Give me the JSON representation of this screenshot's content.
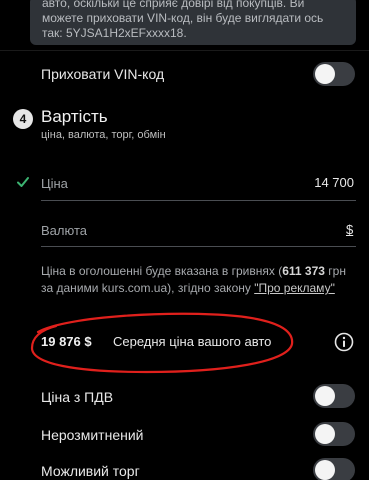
{
  "vin_info": {
    "line1": "авто, оскільки це сприяє довірі від покупців. Ви",
    "line2": "можете приховати VIN-код, він буде виглядати ось",
    "line3": "так: 5YJSA1H2xEFxxxx18."
  },
  "hide_vin": {
    "label": "Приховати VIN-код",
    "enabled": false
  },
  "price_section": {
    "step_number": "4",
    "title": "Вартість",
    "subtitle": "ціна, валюта, торг, обмін"
  },
  "price_field": {
    "label": "Ціна",
    "value": "14 700"
  },
  "currency_field": {
    "label": "Валюта",
    "value": "$"
  },
  "conversion_note": {
    "text_before": "Ціна в оголошенні буде вказана в гривнях (",
    "uah_amount": "611 373",
    "text_middle": " грн за даними kurs.com.ua), згідно закону ",
    "link_text": "\"Про рекламу\""
  },
  "average_price": {
    "value": "19 876 $",
    "label": "Середня ціна вашого авто"
  },
  "toggles": [
    {
      "label": "Ціна з ПДВ",
      "enabled": false
    },
    {
      "label": "Нерозмитнений",
      "enabled": false
    },
    {
      "label": "Можливий торг",
      "enabled": false
    }
  ],
  "colors": {
    "background": "#000000",
    "check": "#3cb371",
    "annotation": "#e0201c",
    "toggle_off": "#3a3d42"
  }
}
